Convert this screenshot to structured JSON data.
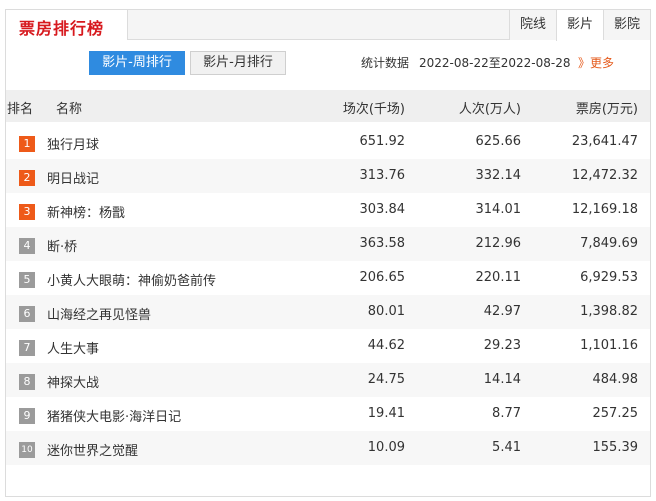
{
  "header": {
    "title": "票房排行榜",
    "tabs": [
      "院线",
      "影片",
      "影院"
    ],
    "active_tab": "影片"
  },
  "toolbar": {
    "weekly_label": "影片-周排行",
    "monthly_label": "影片-月排行",
    "stats_label": "统计数据",
    "date_range": "2022-08-22至2022-08-28",
    "more_label": "》更多"
  },
  "table": {
    "headers": {
      "rank": "排名",
      "name": "名称",
      "shows": "场次(千场)",
      "people": "人次(万人)",
      "box": "票房(万元)"
    },
    "rows": [
      {
        "rank": "1",
        "name": "独行月球",
        "shows": "651.92",
        "people": "625.66",
        "box": "23,641.47"
      },
      {
        "rank": "2",
        "name": "明日战记",
        "shows": "313.76",
        "people": "332.14",
        "box": "12,472.32"
      },
      {
        "rank": "3",
        "name": "新神榜：杨戬",
        "shows": "303.84",
        "people": "314.01",
        "box": "12,169.18"
      },
      {
        "rank": "4",
        "name": "断·桥",
        "shows": "363.58",
        "people": "212.96",
        "box": "7,849.69"
      },
      {
        "rank": "5",
        "name": "小黄人大眼萌：神偷奶爸前传",
        "shows": "206.65",
        "people": "220.11",
        "box": "6,929.53"
      },
      {
        "rank": "6",
        "name": "山海经之再见怪兽",
        "shows": "80.01",
        "people": "42.97",
        "box": "1,398.82"
      },
      {
        "rank": "7",
        "name": "人生大事",
        "shows": "44.62",
        "people": "29.23",
        "box": "1,101.16"
      },
      {
        "rank": "8",
        "name": "神探大战",
        "shows": "24.75",
        "people": "14.14",
        "box": "484.98"
      },
      {
        "rank": "9",
        "name": "猪猪侠大电影·海洋日记",
        "shows": "19.41",
        "people": "8.77",
        "box": "257.25"
      },
      {
        "rank": "10",
        "name": "迷你世界之觉醒",
        "shows": "10.09",
        "people": "5.41",
        "box": "155.39"
      }
    ]
  },
  "colors": {
    "brand": "#d7191e",
    "accent": "#2f8be0",
    "top_rank": "#ee5a19",
    "rank": "#9b9b9b",
    "more": "#e55a1b"
  }
}
